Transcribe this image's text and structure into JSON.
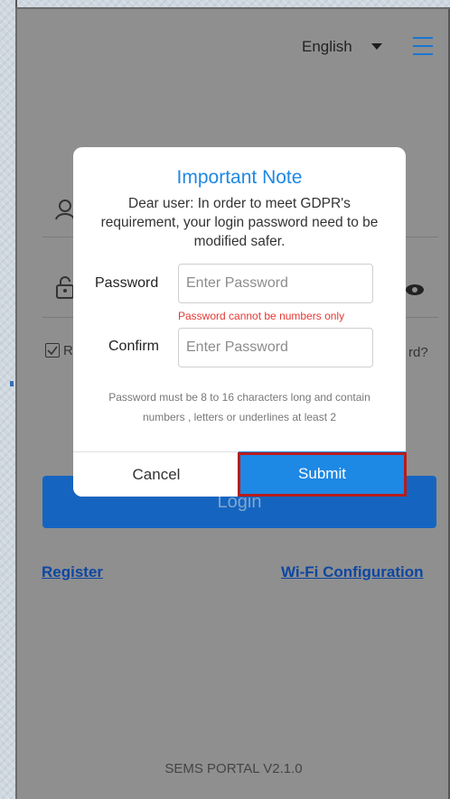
{
  "header": {
    "language": "English",
    "language_icon": "caret-down-icon",
    "menu_icon": "hamburger-menu-icon"
  },
  "login_form": {
    "remember_letter": "R",
    "forgot_partial": "rd?",
    "login_label": "Login"
  },
  "links": {
    "register": "Register",
    "wifi_config": "Wi-Fi Configuration"
  },
  "footer": {
    "version": "SEMS PORTAL V2.1.0"
  },
  "modal": {
    "title": "Important Note",
    "message": "Dear user: In order to meet GDPR's requirement, your login password need to be modified safer.",
    "password_label": "Password",
    "password_placeholder": "Enter Password",
    "password_error": "Password cannot be numbers only",
    "confirm_label": "Confirm",
    "confirm_placeholder": "Enter Password",
    "hint_line1": "Password must be 8 to 16 characters long and contain",
    "hint_line2": "numbers , letters or underlines at least 2",
    "cancel_label": "Cancel",
    "submit_label": "Submit"
  },
  "colors": {
    "accent": "#1e88e5",
    "error": "#e53935",
    "highlight": "#b71c1c",
    "overlay": "#8f8f8f"
  }
}
